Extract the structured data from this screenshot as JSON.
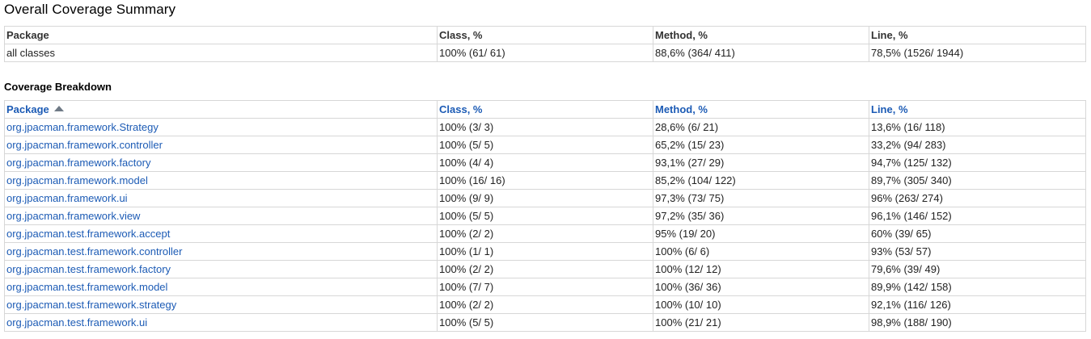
{
  "overall": {
    "title": "Overall Coverage Summary",
    "headers": [
      "Package",
      "Class, %",
      "Method, %",
      "Line, %"
    ],
    "row": {
      "package": "all classes",
      "class": "100% (61/ 61)",
      "method": "88,6% (364/ 411)",
      "line": "78,5% (1526/ 1944)"
    }
  },
  "breakdown": {
    "title": "Coverage Breakdown",
    "headers": [
      "Package",
      "Class, %",
      "Method, %",
      "Line, %"
    ],
    "sort_icon": "sort-ascending-icon",
    "rows": [
      {
        "package": "org.jpacman.framework.Strategy",
        "class": "100% (3/ 3)",
        "method": "28,6% (6/ 21)",
        "line": "13,6% (16/ 118)"
      },
      {
        "package": "org.jpacman.framework.controller",
        "class": "100% (5/ 5)",
        "method": "65,2% (15/ 23)",
        "line": "33,2% (94/ 283)"
      },
      {
        "package": "org.jpacman.framework.factory",
        "class": "100% (4/ 4)",
        "method": "93,1% (27/ 29)",
        "line": "94,7% (125/ 132)"
      },
      {
        "package": "org.jpacman.framework.model",
        "class": "100% (16/ 16)",
        "method": "85,2% (104/ 122)",
        "line": "89,7% (305/ 340)"
      },
      {
        "package": "org.jpacman.framework.ui",
        "class": "100% (9/ 9)",
        "method": "97,3% (73/ 75)",
        "line": "96% (263/ 274)"
      },
      {
        "package": "org.jpacman.framework.view",
        "class": "100% (5/ 5)",
        "method": "97,2% (35/ 36)",
        "line": "96,1% (146/ 152)"
      },
      {
        "package": "org.jpacman.test.framework.accept",
        "class": "100% (2/ 2)",
        "method": "95% (19/ 20)",
        "line": "60% (39/ 65)"
      },
      {
        "package": "org.jpacman.test.framework.controller",
        "class": "100% (1/ 1)",
        "method": "100% (6/ 6)",
        "line": "93% (53/ 57)"
      },
      {
        "package": "org.jpacman.test.framework.factory",
        "class": "100% (2/ 2)",
        "method": "100% (12/ 12)",
        "line": "79,6% (39/ 49)"
      },
      {
        "package": "org.jpacman.test.framework.model",
        "class": "100% (7/ 7)",
        "method": "100% (36/ 36)",
        "line": "89,9% (142/ 158)"
      },
      {
        "package": "org.jpacman.test.framework.strategy",
        "class": "100% (2/ 2)",
        "method": "100% (10/ 10)",
        "line": "92,1% (116/ 126)"
      },
      {
        "package": "org.jpacman.test.framework.ui",
        "class": "100% (5/ 5)",
        "method": "100% (21/ 21)",
        "line": "98,9% (188/ 190)"
      }
    ]
  },
  "colors": {
    "link": "#1c5bb5",
    "border": "#d7d7d7"
  }
}
